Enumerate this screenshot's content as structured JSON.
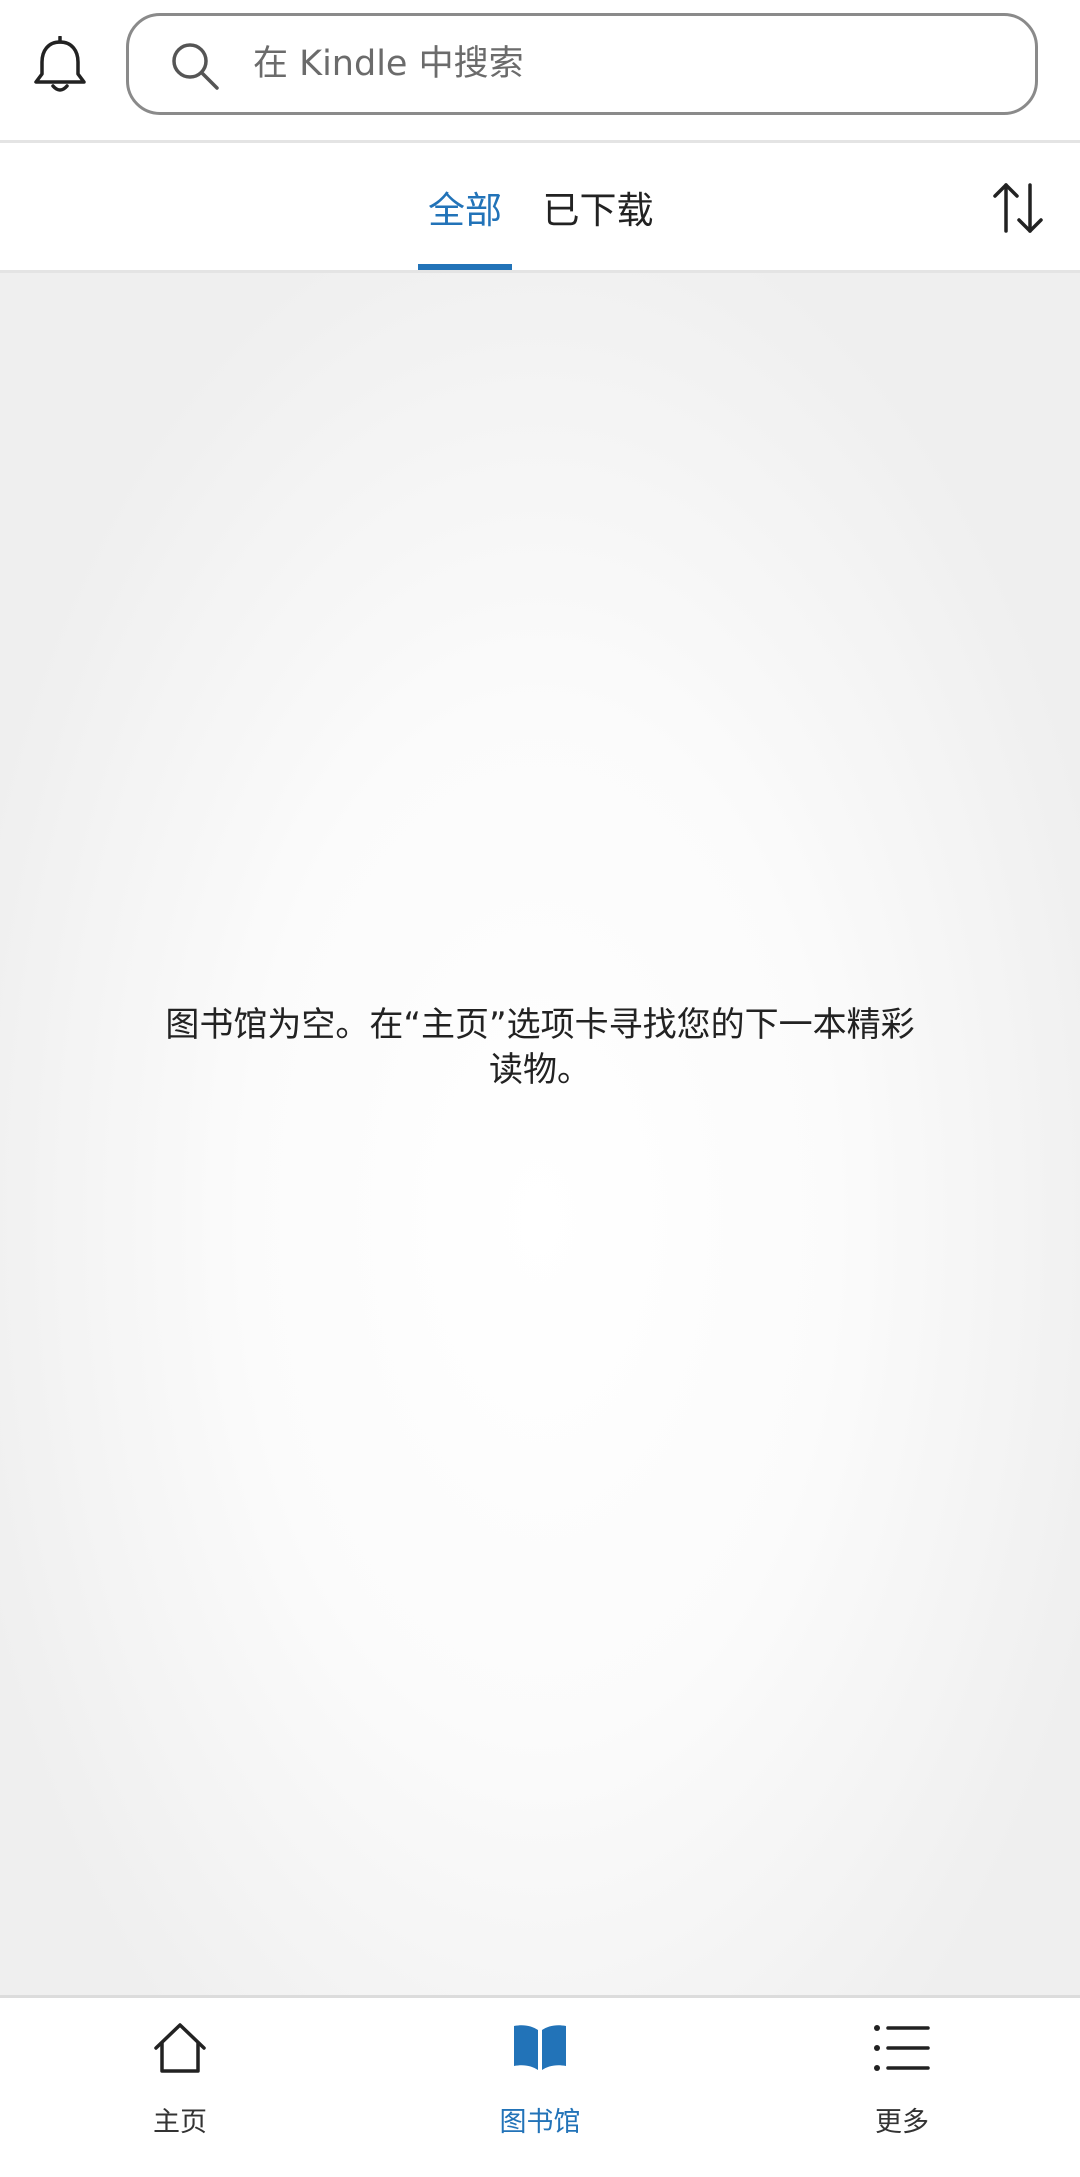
{
  "header": {
    "search": {
      "placeholder": "在 Kindle 中搜索",
      "value": ""
    }
  },
  "tabs": [
    {
      "label": "全部",
      "selected": true
    },
    {
      "label": "已下载",
      "selected": false
    }
  ],
  "content": {
    "empty_message": "图书馆为空。在“主页”选项卡寻找您的下一本精彩读物。"
  },
  "bottom_nav": [
    {
      "label": "主页",
      "icon": "home-icon",
      "active": false
    },
    {
      "label": "图书馆",
      "icon": "book-icon",
      "active": true
    },
    {
      "label": "更多",
      "icon": "list-icon",
      "active": false
    }
  ],
  "colors": {
    "accent": "#2273b8",
    "text": "#222222",
    "divider": "#e4e4e4"
  }
}
